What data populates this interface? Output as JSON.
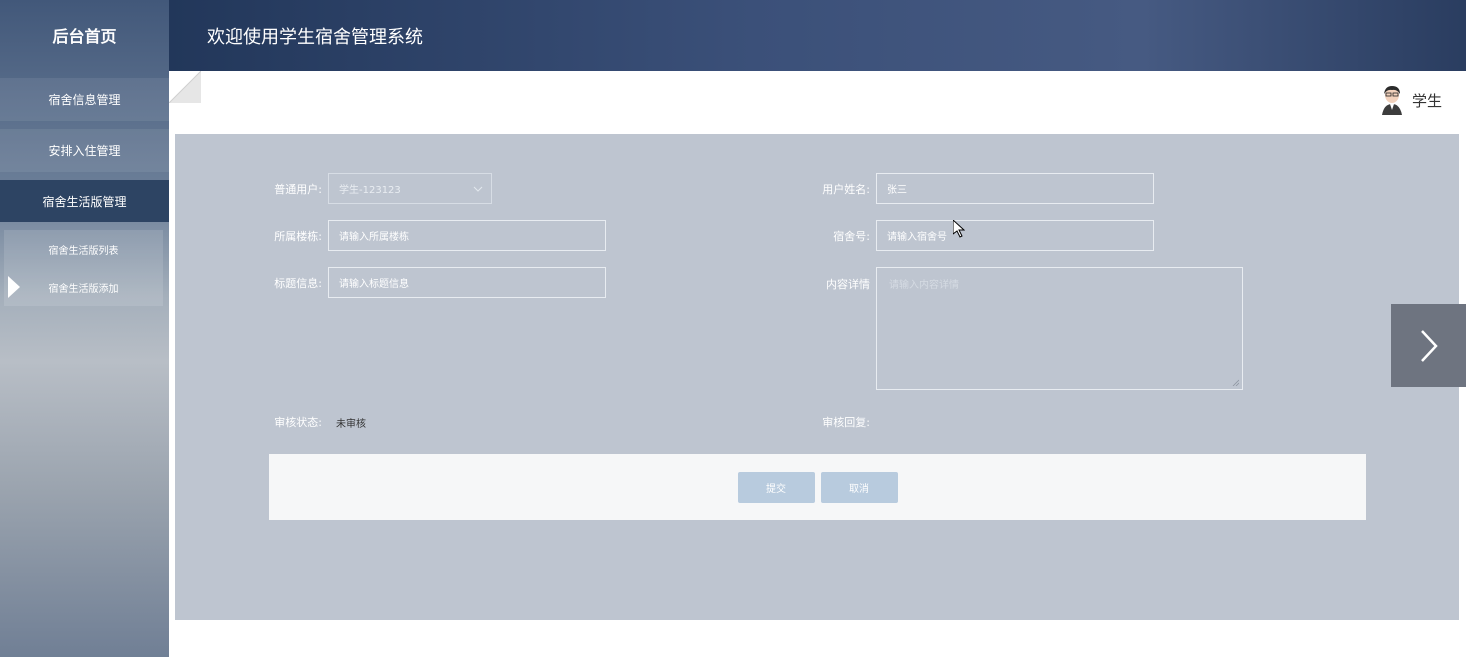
{
  "sidebar": {
    "brand": "后台首页",
    "items": [
      {
        "label": "宿舍信息管理"
      },
      {
        "label": "安排入住管理"
      },
      {
        "label": "宿舍生活版管理"
      }
    ],
    "subitems": [
      {
        "label": "宿舍生活版列表"
      },
      {
        "label": "宿舍生活版添加"
      }
    ]
  },
  "header": {
    "title": "欢迎使用学生宿舍管理系统",
    "user": "学生"
  },
  "form": {
    "user_label": "普通用户:",
    "user_value": "学生-123123",
    "name_label": "用户姓名:",
    "name_value": "张三",
    "building_label": "所属楼栋:",
    "building_placeholder": "请输入所属楼栋",
    "room_label": "宿舍号:",
    "room_placeholder": "请输入宿舍号",
    "title_label": "标题信息:",
    "title_placeholder": "请输入标题信息",
    "content_label": "内容详情",
    "content_placeholder": "请输入内容详情",
    "status_label": "审核状态:",
    "status_value": "未审核",
    "reply_label": "审核回复:"
  },
  "actions": {
    "submit": "提交",
    "cancel": "取消"
  },
  "colors": {
    "panel": "#bec5d0",
    "button": "#b8cbde",
    "sidebar_active": "#2d4463"
  }
}
